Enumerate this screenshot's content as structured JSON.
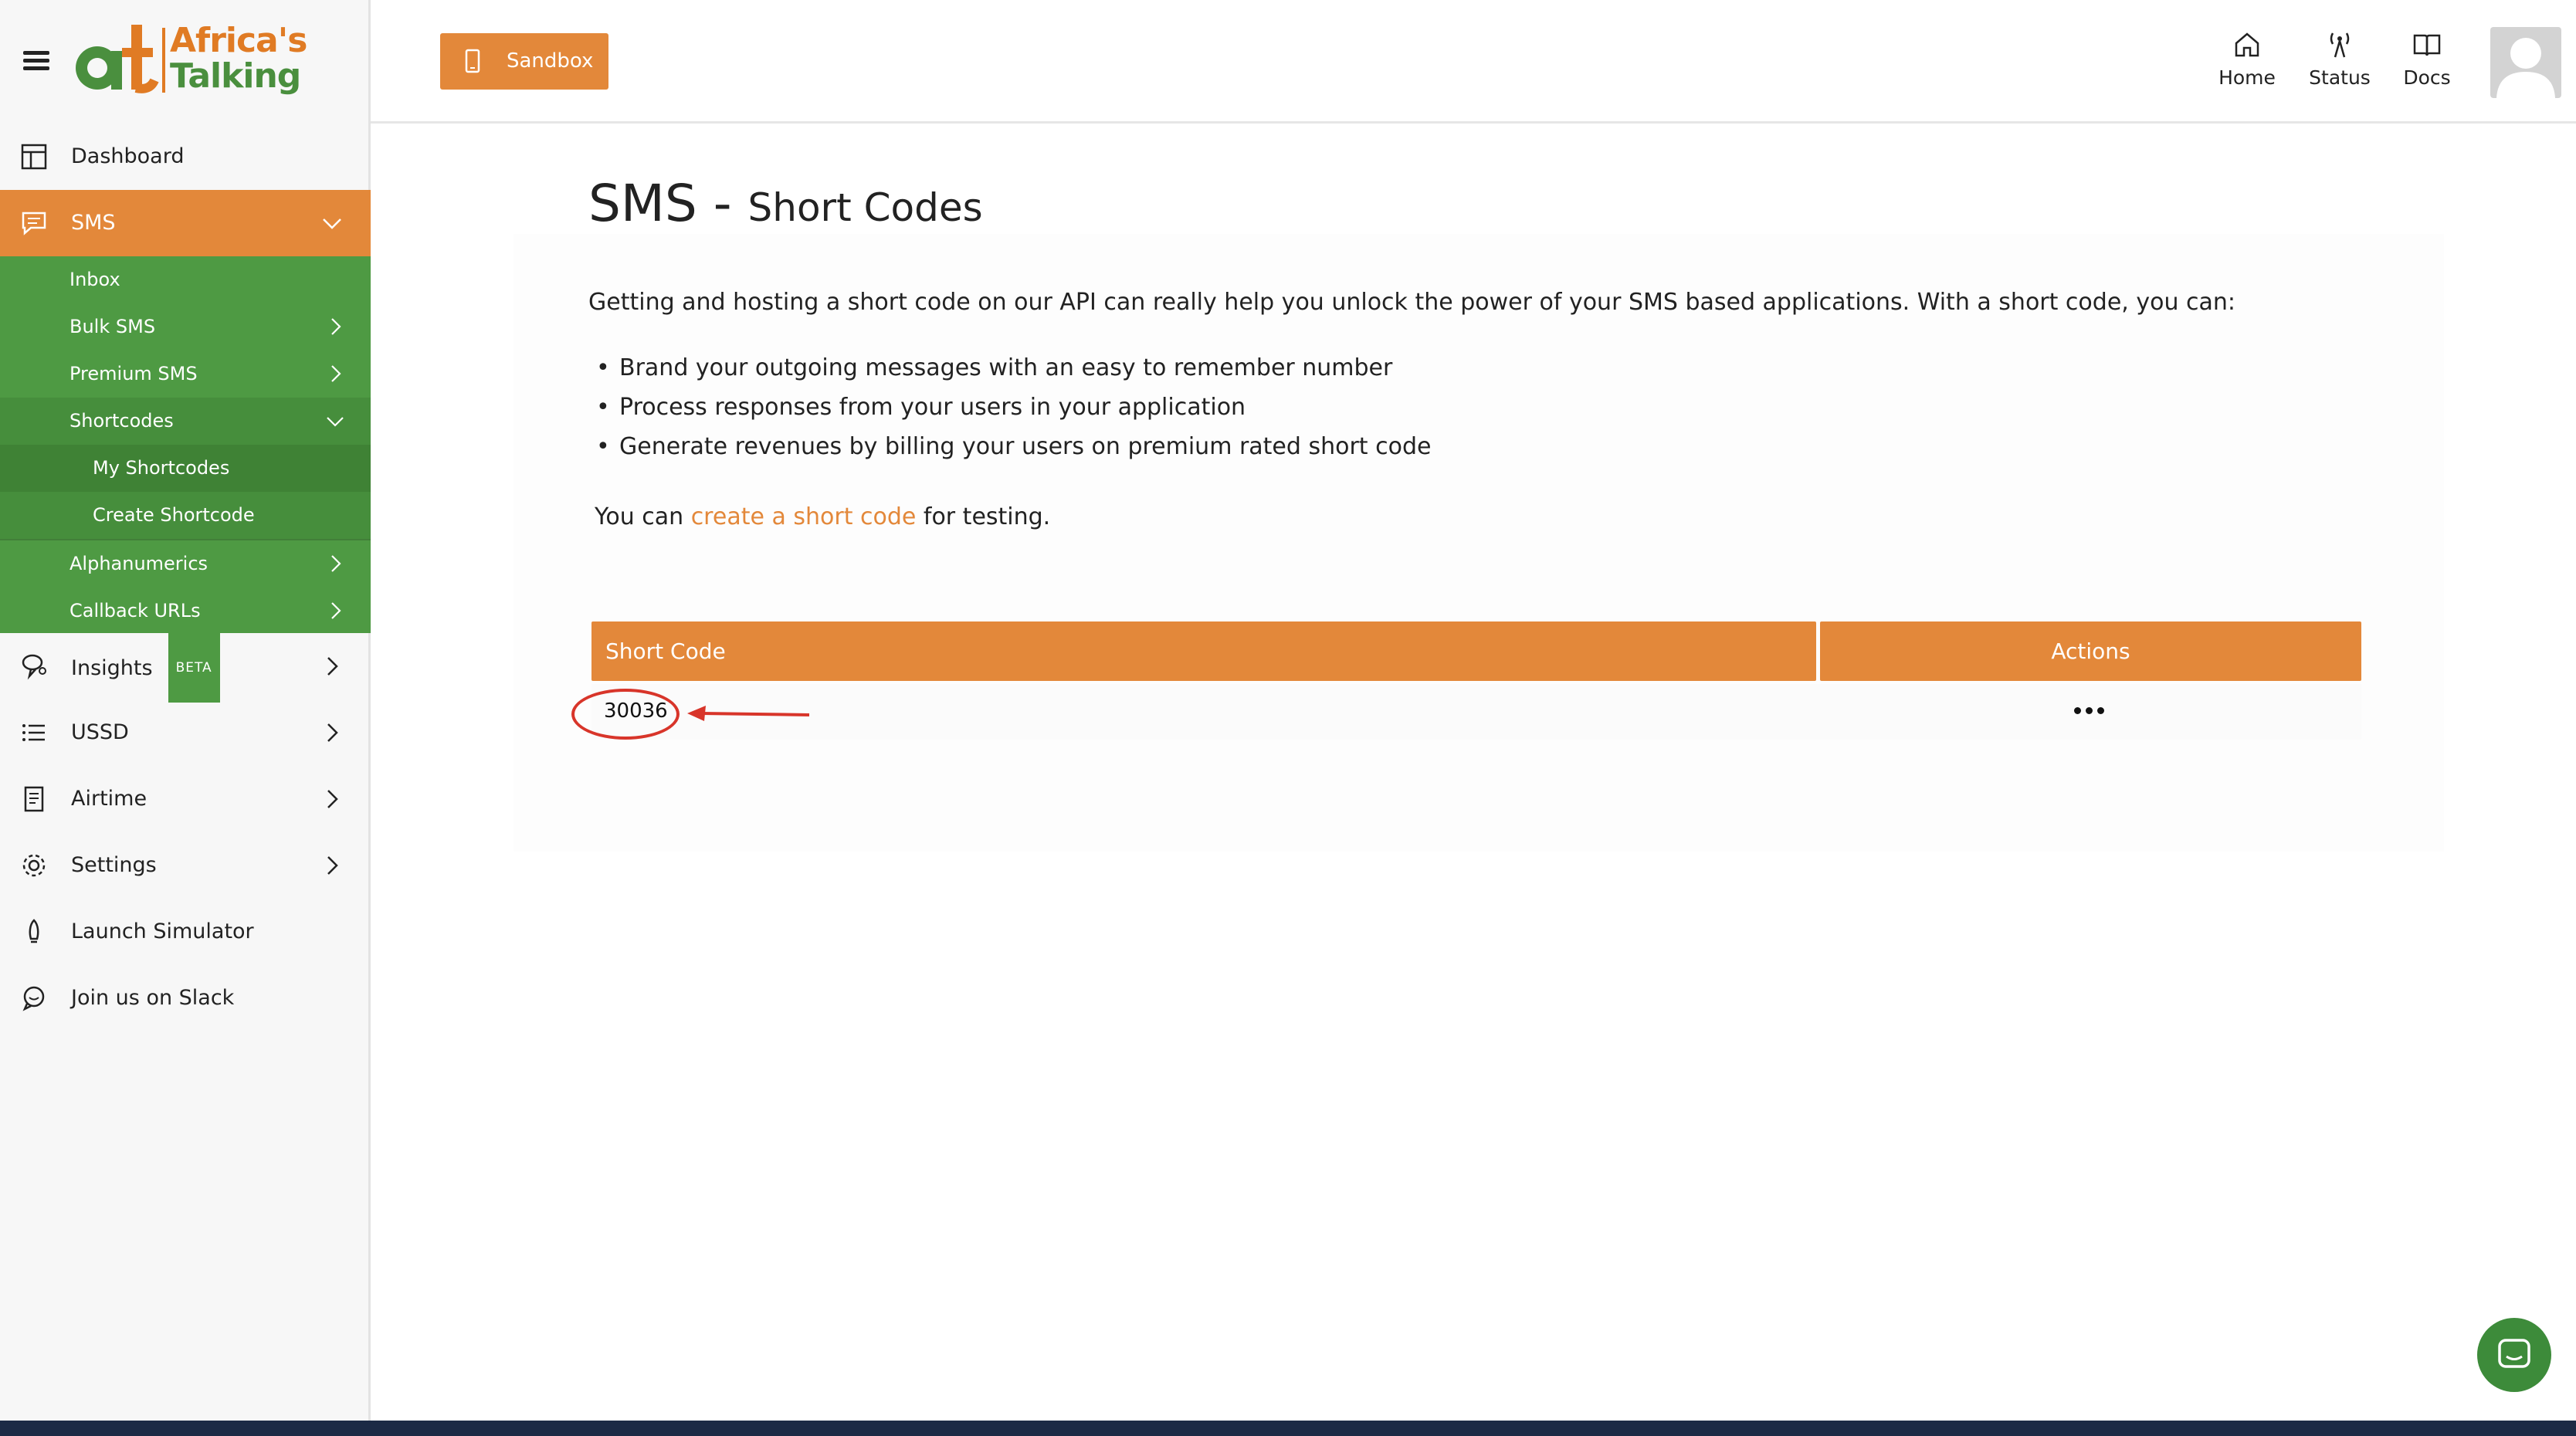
{
  "brand": {
    "logo_word1": "Africa's",
    "logo_word2": "Talking",
    "colors": {
      "orange": "#e3883a",
      "green": "#4e9a43",
      "dark_green": "#3f8235"
    }
  },
  "sidebar": {
    "items": {
      "dashboard": {
        "label": "Dashboard",
        "icon": "layout-icon"
      },
      "sms": {
        "label": "SMS",
        "icon": "message-icon"
      },
      "insights": {
        "label": "Insights",
        "badge": "BETA",
        "icon": "insights-icon"
      },
      "ussd": {
        "label": "USSD",
        "icon": "list-icon"
      },
      "airtime": {
        "label": "Airtime",
        "icon": "receipt-icon"
      },
      "settings": {
        "label": "Settings",
        "icon": "gear-icon"
      },
      "simulator": {
        "label": "Launch Simulator",
        "icon": "rocket-icon"
      },
      "slack": {
        "label": "Join us on Slack",
        "icon": "chat-icon"
      }
    },
    "sms_sub": {
      "inbox": "Inbox",
      "bulk": "Bulk SMS",
      "premium": "Premium SMS",
      "shortcodes": "Shortcodes",
      "my_shortcodes": "My Shortcodes",
      "create_shortcode": "Create Shortcode",
      "alphanumerics": "Alphanumerics",
      "callbacks": "Callback URLs"
    }
  },
  "topbar": {
    "sandbox_label": "Sandbox",
    "links": {
      "home": "Home",
      "status": "Status",
      "docs": "Docs"
    }
  },
  "main": {
    "title": "SMS",
    "title_sep": " - ",
    "subtitle": "Short Codes",
    "intro": "Getting and hosting a short code on our API can really help you unlock the power of your SMS based applications. With a short code, you can:",
    "bullets": [
      "Brand your outgoing messages with an easy to remember number",
      "Process responses from your users in your application",
      "Generate revenues by billing your users on premium rated short code"
    ],
    "cta_prefix": "You can ",
    "cta_link": "create a short code",
    "cta_suffix": " for testing."
  },
  "table": {
    "headers": {
      "code": "Short Code",
      "actions": "Actions"
    },
    "rows": [
      {
        "code": "30036"
      }
    ]
  }
}
